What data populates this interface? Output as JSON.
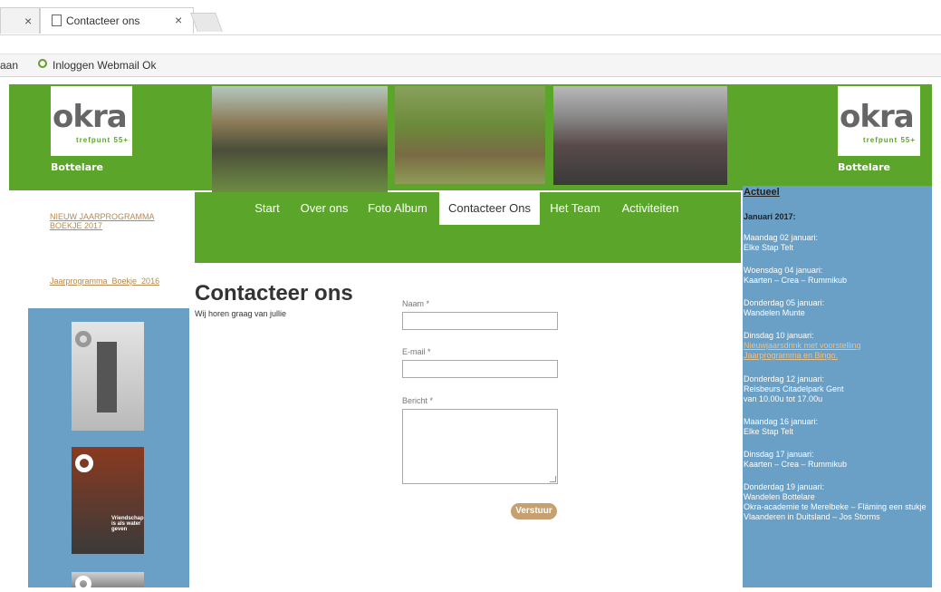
{
  "browser": {
    "tabs": [
      {
        "title": "",
        "close": "×"
      },
      {
        "title": "Contacteer ons",
        "close": "×"
      }
    ],
    "bookmarks": [
      {
        "label": "aan"
      },
      {
        "label": "Inloggen Webmail Ok"
      }
    ]
  },
  "site": {
    "logo_word": "okra",
    "logo_sub": "trefpunt 55+",
    "location": "Bottelare",
    "nav": [
      "Start",
      "Over ons",
      "Foto Album",
      "Contacteer Ons",
      "Het Team",
      "Activiteiten"
    ],
    "active_nav": "Contacteer Ons",
    "sidebar_links": [
      "NIEUW JAARPROGRAMMA BOEKJE 2017",
      "Jaarprogramma_Boekje_2016"
    ],
    "magazine_caption_2": "Vriendschap is als water geven"
  },
  "main": {
    "title": "Contacteer ons",
    "subtitle": "Wij horen graag van jullie",
    "form": {
      "name_label": "Naam *",
      "email_label": "E-mail *",
      "message_label": "Bericht *",
      "submit": "Verstuur"
    }
  },
  "aside": {
    "title": "Actueel",
    "month": "Januari 2017:",
    "events": [
      {
        "date": "Maandag 02 januari:",
        "lines": [
          "Elke Stap Telt"
        ]
      },
      {
        "date": "Woensdag 04 januari:",
        "lines": [
          "Kaarten – Crea – Rummikub"
        ]
      },
      {
        "date": "Donderdag 05 januari:",
        "lines": [
          "Wandelen Munte"
        ]
      },
      {
        "date": "Dinsdag 10 januari:",
        "link": "Nieuwjaarsdrink met voorstelling Jaarprogramma en Bingo."
      },
      {
        "date": "Donderdag 12 januari:",
        "lines": [
          "Reisbeurs Citadelpark Gent",
          "van 10.00u tot 17.00u"
        ]
      },
      {
        "date": "Maandag 16 januari:",
        "lines": [
          "Elke Stap Telt"
        ]
      },
      {
        "date": "Dinsdag 17 januari:",
        "lines": [
          "Kaarten – Crea – Rummikub"
        ]
      },
      {
        "date": "Donderdag 19 januari:",
        "lines": [
          "Wandelen Bottelare",
          "Okra-academie te Merelbeke – Fläming een stukje Vlaanderen in Duitsland – Jos Storms"
        ]
      }
    ]
  },
  "colors": {
    "green": "#5ba52b",
    "blue": "#6a9fc6",
    "link": "#b68a4f"
  }
}
